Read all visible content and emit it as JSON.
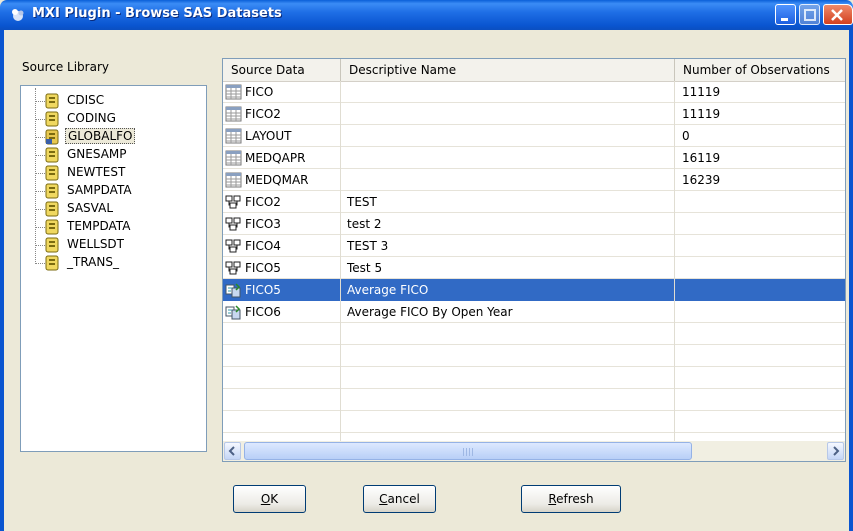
{
  "window": {
    "title": "MXI Plugin - Browse SAS Datasets"
  },
  "library": {
    "label": "Source Library",
    "items": [
      "CDISC",
      "CODING",
      "GLOBALFO",
      "GNESAMP",
      "NEWTEST",
      "SAMPDATA",
      "SASVAL",
      "TEMPDATA",
      "WELLSDT",
      "_TRANS_"
    ],
    "selected": "GLOBALFO"
  },
  "table": {
    "columns": [
      "Source Data",
      "Descriptive Name",
      "Number of Observations"
    ],
    "rows": [
      {
        "icon": "dataset-icon",
        "source": "FICO",
        "name": "",
        "obs": "11119"
      },
      {
        "icon": "dataset-icon",
        "source": "FICO2",
        "name": "",
        "obs": "11119"
      },
      {
        "icon": "dataset-icon",
        "source": "LAYOUT",
        "name": "",
        "obs": "0"
      },
      {
        "icon": "dataset-icon",
        "source": "MEDQAPR",
        "name": "",
        "obs": "16119"
      },
      {
        "icon": "dataset-icon",
        "source": "MEDQMAR",
        "name": "",
        "obs": "16239"
      },
      {
        "icon": "view-icon",
        "source": "FICO2",
        "name": "TEST",
        "obs": ""
      },
      {
        "icon": "view-icon",
        "source": "FICO3",
        "name": "test 2",
        "obs": ""
      },
      {
        "icon": "view-icon",
        "source": "FICO4",
        "name": "TEST 3",
        "obs": ""
      },
      {
        "icon": "view-icon",
        "source": "FICO5",
        "name": "Test 5",
        "obs": ""
      },
      {
        "icon": "query-icon",
        "source": "FICO5",
        "name": "Average FICO",
        "obs": "",
        "selected": true
      },
      {
        "icon": "query-icon",
        "source": "FICO6",
        "name": "Average FICO By Open Year",
        "obs": ""
      }
    ]
  },
  "buttons": {
    "ok_hot": "O",
    "ok_rest": "K",
    "cancel_hot": "C",
    "cancel_rest": "ancel",
    "refresh_hot": "R",
    "refresh_rest": "efresh"
  },
  "colors": {
    "titlebar": "#0a55d0",
    "selection": "#316ac5",
    "dialog": "#ece9d8"
  }
}
